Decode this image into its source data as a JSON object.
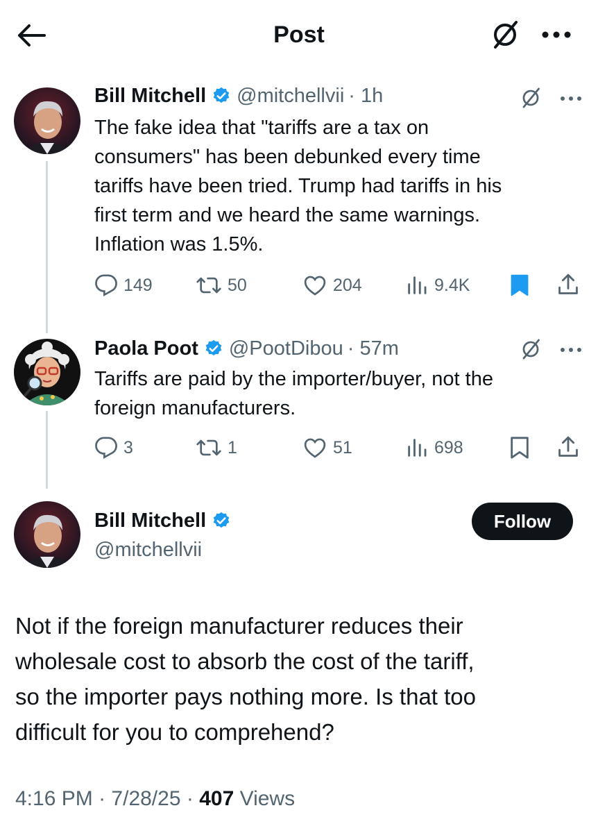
{
  "header": {
    "title": "Post"
  },
  "tweets": [
    {
      "name": "Bill Mitchell",
      "handle": "@mitchellvii",
      "time": "· 1h",
      "text_lines": [
        "The fake idea that \"tariffs are a tax on",
        "consumers\" has been debunked every time",
        "tariffs have been tried.  Trump had tariffs in his",
        "first term and we heard the same warnings.",
        "Inflation was 1.5%."
      ],
      "replies": "149",
      "reposts": "50",
      "likes": "204",
      "views": "9.4K",
      "bookmarked": true
    },
    {
      "name": "Paola Poot",
      "handle": "@PootDibou",
      "time": "· 57m",
      "text_lines": [
        "Tariffs are paid by the importer/buyer, not the",
        "foreign manufacturers."
      ],
      "replies": "3",
      "reposts": "1",
      "likes": "51",
      "views": "698",
      "bookmarked": false
    }
  ],
  "main": {
    "name": "Bill Mitchell",
    "handle": "@mitchellvii",
    "follow_label": "Follow",
    "text_lines": [
      "Not if the foreign manufacturer reduces their",
      "wholesale cost to absorb the cost of the tariff,",
      "so the importer pays nothing more. Is that too",
      "difficult for you to comprehend?"
    ],
    "time": "4:16 PM",
    "date": "7/28/25",
    "views_count": "407",
    "views_label": "Views",
    "separator": "·"
  },
  "colors": {
    "text": "#0f1419",
    "secondary": "#536471",
    "verified": "#1d9bf0",
    "bookmark_active": "#1d9bf0",
    "thread_line": "#cfd9de"
  },
  "icons": [
    "back-arrow-icon",
    "grok-icon",
    "more-icon",
    "verified-badge-icon",
    "reply-icon",
    "repost-icon",
    "like-icon",
    "views-icon",
    "bookmark-icon",
    "share-icon"
  ]
}
